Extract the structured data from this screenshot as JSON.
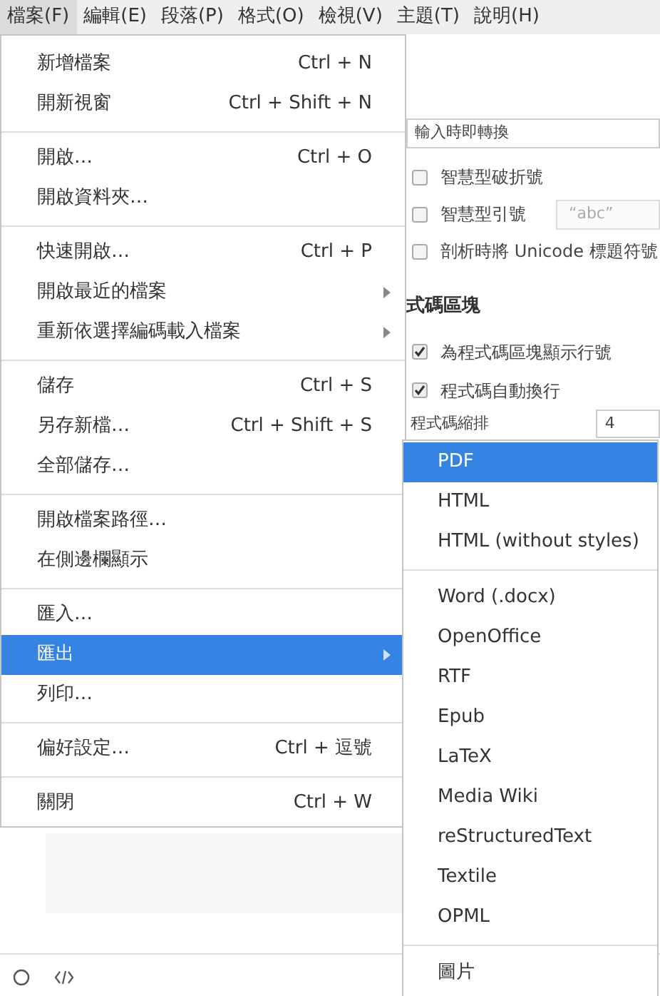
{
  "menubar": [
    {
      "label": "檔案(F)",
      "selected": true
    },
    {
      "label": "編輯(E)",
      "selected": false
    },
    {
      "label": "段落(P)",
      "selected": false
    },
    {
      "label": "格式(O)",
      "selected": false
    },
    {
      "label": "檢視(V)",
      "selected": false
    },
    {
      "label": "主題(T)",
      "selected": false
    },
    {
      "label": "說明(H)",
      "selected": false
    }
  ],
  "settings": {
    "conversion_field": {
      "value": "輸入時即轉換"
    },
    "options": [
      {
        "label": "智慧型破折號",
        "checked": false
      },
      {
        "label": "智慧型引號",
        "checked": false,
        "dropdown": "“abc”"
      },
      {
        "label": "剖析時將 Unicode 標題符號",
        "checked": false
      }
    ],
    "heading": "式碼區塊",
    "code_options": [
      {
        "label": "為程式碼區塊顯示行號",
        "checked": true
      },
      {
        "label": "程式碼自動換行",
        "checked": true
      }
    ],
    "indent": {
      "label": "程式碼縮排",
      "value": "4"
    }
  },
  "file_menu": [
    {
      "kind": "item",
      "label": "新增檔案",
      "shortcut": "Ctrl + N",
      "has_submenu": false,
      "selected": false
    },
    {
      "kind": "item",
      "label": "開新視窗",
      "shortcut": "Ctrl + Shift + N",
      "has_submenu": false,
      "selected": false
    },
    {
      "kind": "separator"
    },
    {
      "kind": "item",
      "label": "開啟…",
      "shortcut": "Ctrl + O",
      "has_submenu": false,
      "selected": false
    },
    {
      "kind": "item",
      "label": "開啟資料夾…",
      "has_submenu": false,
      "selected": false
    },
    {
      "kind": "separator"
    },
    {
      "kind": "item",
      "label": "快速開啟…",
      "shortcut": "Ctrl + P",
      "has_submenu": false,
      "selected": false
    },
    {
      "kind": "item",
      "label": "開啟最近的檔案",
      "has_submenu": true,
      "selected": false
    },
    {
      "kind": "item",
      "label": "重新依選擇編碼載入檔案",
      "has_submenu": true,
      "selected": false
    },
    {
      "kind": "separator"
    },
    {
      "kind": "item",
      "label": "儲存",
      "shortcut": "Ctrl + S",
      "has_submenu": false,
      "selected": false
    },
    {
      "kind": "item",
      "label": "另存新檔…",
      "shortcut": "Ctrl + Shift + S",
      "has_submenu": false,
      "selected": false
    },
    {
      "kind": "item",
      "label": "全部儲存…",
      "has_submenu": false,
      "selected": false
    },
    {
      "kind": "separator"
    },
    {
      "kind": "item",
      "label": "開啟檔案路徑…",
      "has_submenu": false,
      "selected": false
    },
    {
      "kind": "item",
      "label": "在側邊欄顯示",
      "has_submenu": false,
      "selected": false
    },
    {
      "kind": "separator"
    },
    {
      "kind": "item",
      "label": "匯入…",
      "has_submenu": false,
      "selected": false
    },
    {
      "kind": "item",
      "label": "匯出",
      "has_submenu": true,
      "selected": true
    },
    {
      "kind": "item",
      "label": "列印…",
      "has_submenu": false,
      "selected": false
    },
    {
      "kind": "separator"
    },
    {
      "kind": "item",
      "label": "偏好設定…",
      "shortcut": "Ctrl + 逗號",
      "has_submenu": false,
      "selected": false
    },
    {
      "kind": "separator"
    },
    {
      "kind": "item",
      "label": "關閉",
      "shortcut": "Ctrl + W",
      "has_submenu": false,
      "selected": false
    }
  ],
  "export_submenu": [
    {
      "kind": "item",
      "label": "PDF",
      "selected": true
    },
    {
      "kind": "item",
      "label": "HTML",
      "selected": false
    },
    {
      "kind": "item",
      "label": "HTML (without styles)",
      "selected": false
    },
    {
      "kind": "separator"
    },
    {
      "kind": "item",
      "label": "Word (.docx)",
      "selected": false
    },
    {
      "kind": "item",
      "label": "OpenOffice",
      "selected": false
    },
    {
      "kind": "item",
      "label": "RTF",
      "selected": false
    },
    {
      "kind": "item",
      "label": "Epub",
      "selected": false
    },
    {
      "kind": "item",
      "label": "LaTeX",
      "selected": false
    },
    {
      "kind": "item",
      "label": "Media Wiki",
      "selected": false
    },
    {
      "kind": "item",
      "label": "reStructuredText",
      "selected": false
    },
    {
      "kind": "item",
      "label": "Textile",
      "selected": false
    },
    {
      "kind": "item",
      "label": "OPML",
      "selected": false
    },
    {
      "kind": "separator"
    },
    {
      "kind": "item",
      "label": "圖片",
      "selected": false
    }
  ]
}
